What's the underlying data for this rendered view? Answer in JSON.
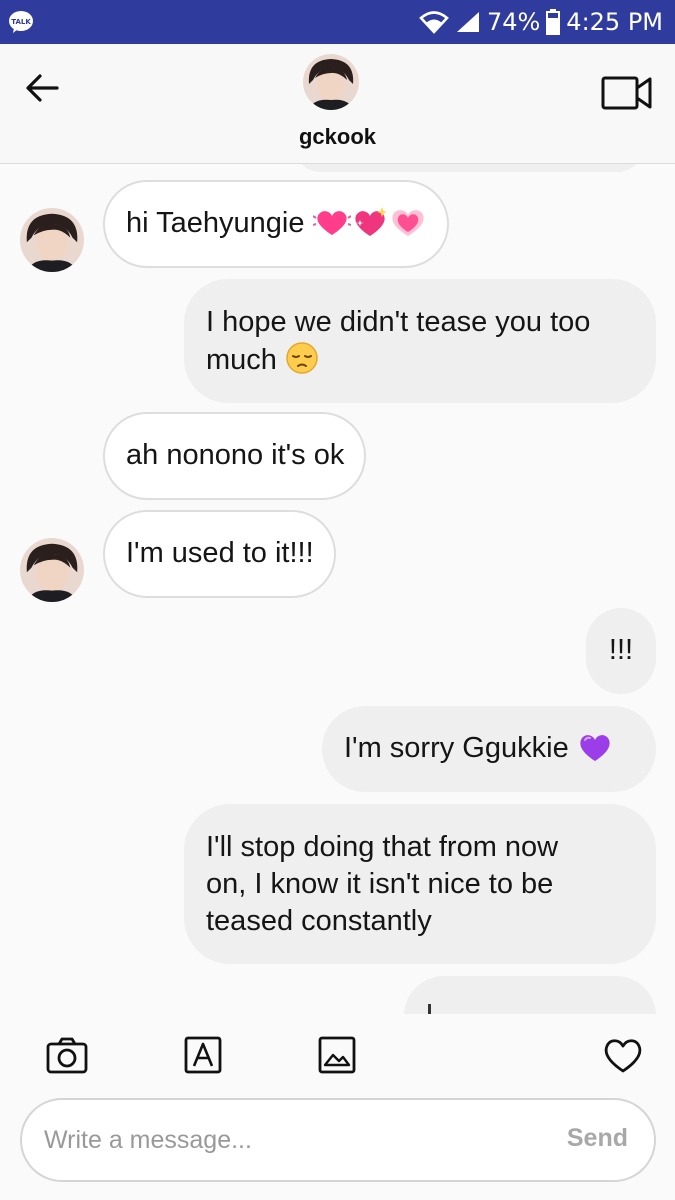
{
  "status_bar": {
    "app_badge": "TALK",
    "battery": "74%",
    "time": "4:25 PM",
    "bar_color": "#2f3c9d"
  },
  "header": {
    "username": "gckook",
    "back_icon": "arrow-left-icon",
    "video_icon": "video-call-icon"
  },
  "messages": [
    {
      "sender": "them",
      "text": "hi Taehyungie",
      "emoji": [
        "revolving-hearts",
        "sparkling-heart",
        "growing-heart"
      ],
      "avatar": true
    },
    {
      "sender": "me",
      "lines": [
        "I hope we didn't tease you too",
        "much"
      ],
      "emoji": [
        "pensive-face"
      ]
    },
    {
      "sender": "them",
      "text": "ah nonono it's ok",
      "avatar": false
    },
    {
      "sender": "them",
      "text": "I'm used to it!!!",
      "avatar": true
    },
    {
      "sender": "me",
      "text": "!!!"
    },
    {
      "sender": "me",
      "text": "I'm sorry Ggukkie",
      "emoji": [
        "purple-heart"
      ]
    },
    {
      "sender": "me",
      "lines": [
        "I'll stop doing that from now",
        "on, I know it isn't nice to be",
        "teased constantly"
      ]
    }
  ],
  "toolbar": {
    "icons": [
      "camera-icon",
      "text-style-icon",
      "gallery-icon",
      "heart-icon"
    ]
  },
  "composer": {
    "placeholder": "Write a message...",
    "send_label": "Send"
  },
  "colors": {
    "incoming_bubble": "#ffffff",
    "outgoing_bubble": "#efefef",
    "heart_pink": "#ff3d8b",
    "heart_purple": "#9b3de8"
  }
}
